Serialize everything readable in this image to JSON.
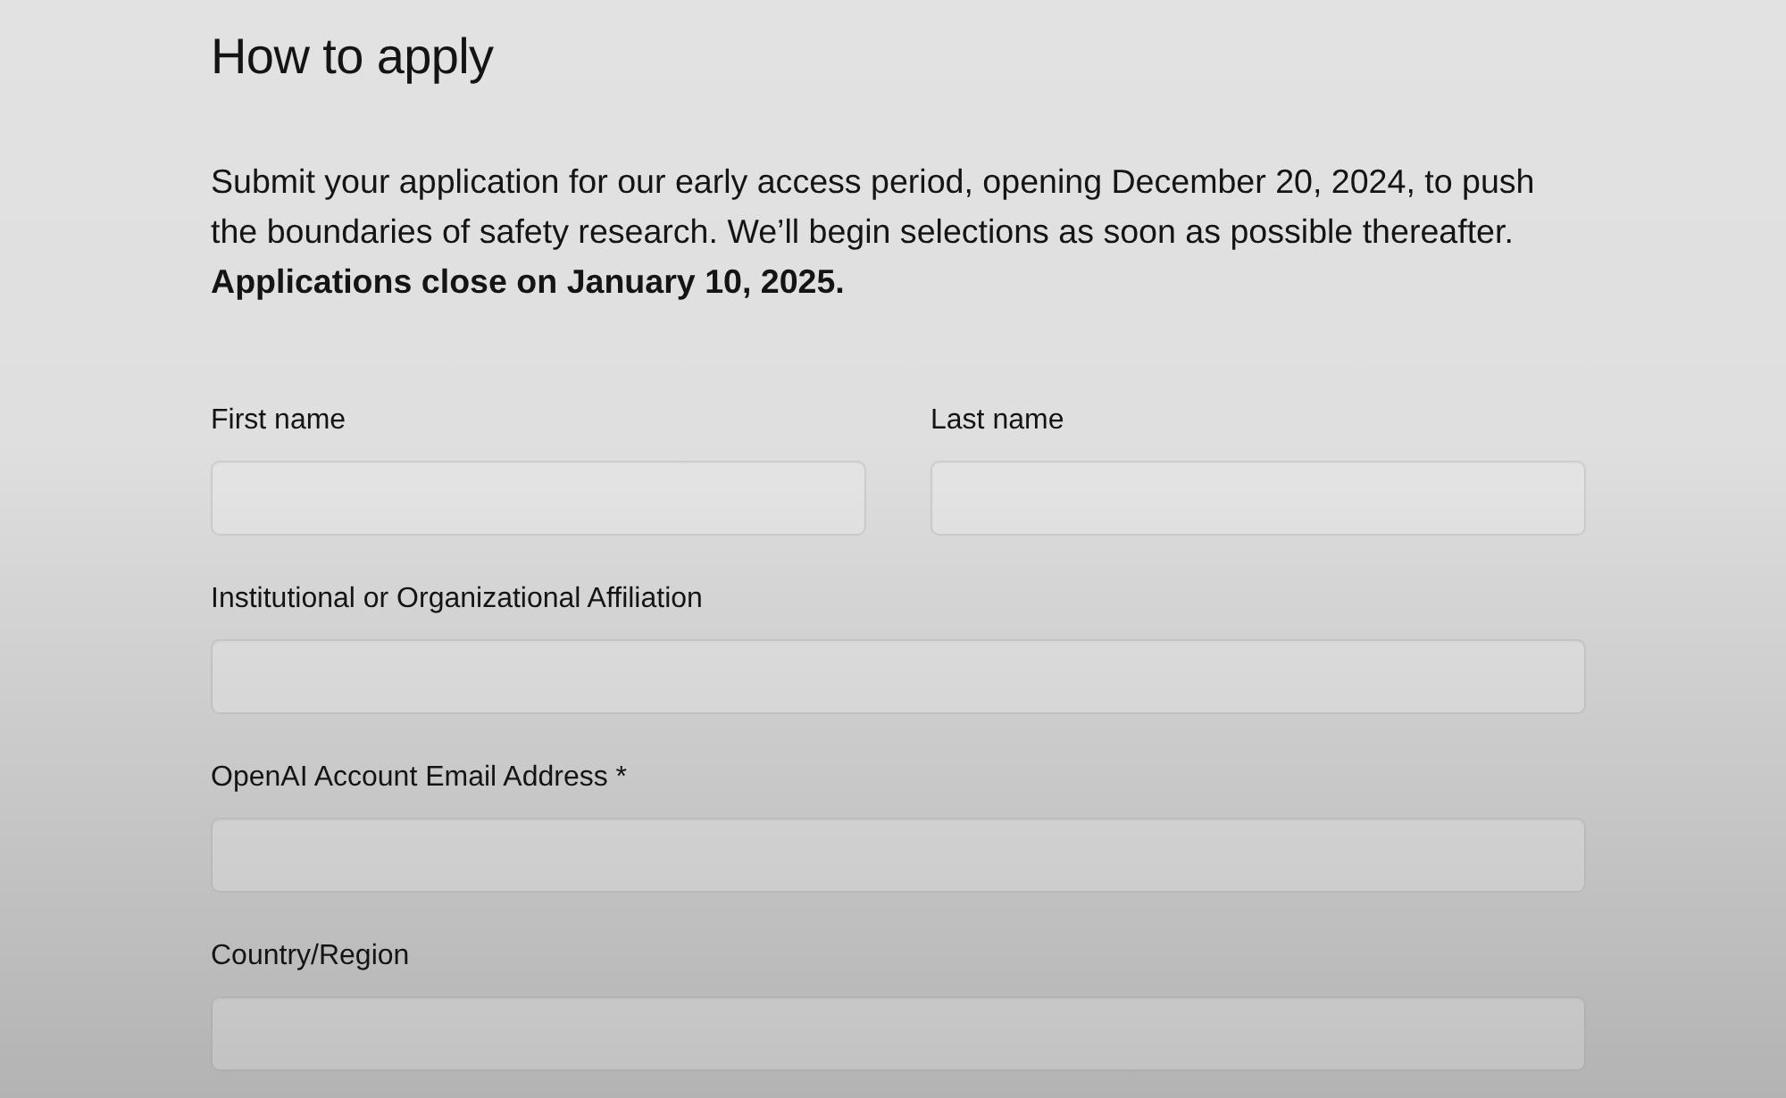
{
  "heading": "How to apply",
  "intro": "Submit your application for our early access period, opening December 20, 2024, to push the boundaries of safety research. We’ll begin selections as soon as possible thereafter. **Applications close on January 10, 2025.**",
  "form": {
    "rows": [
      {
        "fields": [
          {
            "label": "First name"
          },
          {
            "label": "Last name"
          }
        ]
      },
      {
        "fields": [
          {
            "label": "Institutional or Organizational Affiliation"
          }
        ]
      },
      {
        "fields": [
          {
            "label": "OpenAI Account Email Address *"
          }
        ]
      },
      {
        "fields": [
          {
            "label": "Country/Region"
          }
        ]
      }
    ]
  }
}
